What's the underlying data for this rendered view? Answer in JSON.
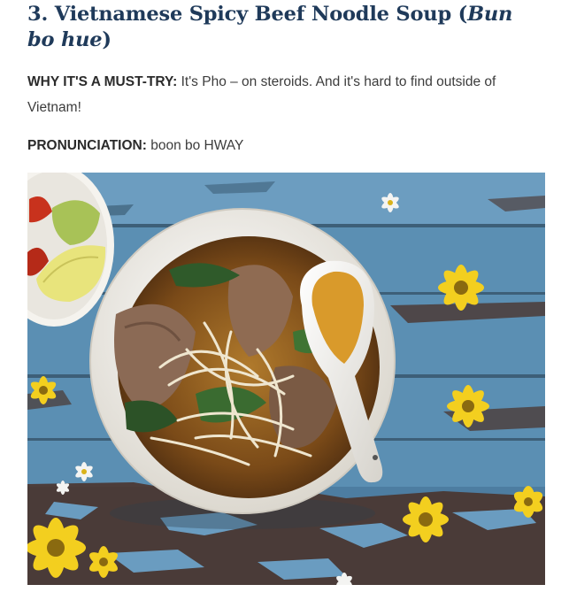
{
  "article": {
    "heading": {
      "number": "3.",
      "title": "Vietnamese Spicy Beef Noodle Soup",
      "local_open": "(",
      "local_name": "Bun bo hue",
      "local_close": ")"
    },
    "why": {
      "label": "WHY IT'S A MUST-TRY:",
      "text": "It's Pho – on steroids. And it's hard to find outside of Vietnam!"
    },
    "pronunciation": {
      "label": "PRONUNCIATION:",
      "text": "boon bo HWAY"
    },
    "photo": {
      "table_color": "#5b8fb3",
      "wood_color": "#4a2f26",
      "bowl_color": "#f7f5f0",
      "broth_color": "#8a5a1e",
      "flower_color": "#f3cf1f"
    }
  }
}
